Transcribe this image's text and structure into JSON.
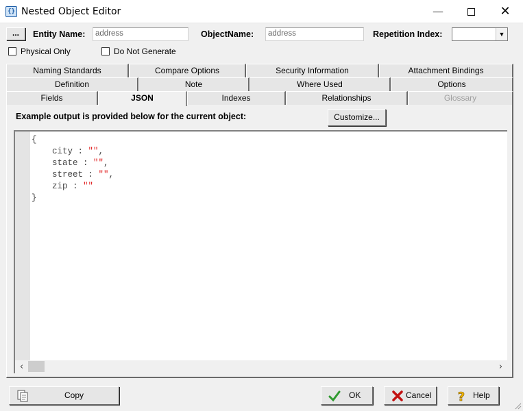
{
  "window": {
    "title": "Nested Object Editor",
    "icon_name": "object-editor-icon"
  },
  "header": {
    "ellipsis_label": "...",
    "entity_name_label": "Entity Name:",
    "entity_name_value": "address",
    "object_name_label": "ObjectName:",
    "object_name_value": "address",
    "repetition_index_label": "Repetition Index:",
    "repetition_index_value": ""
  },
  "options": {
    "physical_only": {
      "label": "Physical Only",
      "checked": false
    },
    "do_not_generate": {
      "label": "Do Not Generate",
      "checked": false
    }
  },
  "tabs": {
    "row1": [
      "Naming Standards",
      "Compare Options",
      "Security Information",
      "Attachment Bindings"
    ],
    "row2": [
      "Definition",
      "Note",
      "Where Used",
      "Options"
    ],
    "row3": [
      "Fields",
      "JSON",
      "Indexes",
      "Relationships",
      "Glossary"
    ],
    "active": "JSON",
    "disabled": [
      "Glossary"
    ]
  },
  "json_tab": {
    "description": "Example output is provided below for the current object:",
    "customize_label": "Customize...",
    "code_lines": [
      {
        "key": "",
        "text": "{"
      },
      {
        "key": "city",
        "value": "\"\"",
        "trail": ","
      },
      {
        "key": "state",
        "value": "\"\"",
        "trail": ","
      },
      {
        "key": "street",
        "value": "\"\"",
        "trail": ","
      },
      {
        "key": "zip",
        "value": "\"\"",
        "trail": ""
      },
      {
        "key": "",
        "text": "}"
      }
    ]
  },
  "footer": {
    "copy_label": "Copy",
    "ok_label": "OK",
    "cancel_label": "Cancel",
    "help_label": "Help"
  },
  "colors": {
    "string_literal": "#e02020",
    "ok_check": "#2f9a2f",
    "cancel_x": "#c21010",
    "help_icon": "#f2b400"
  }
}
